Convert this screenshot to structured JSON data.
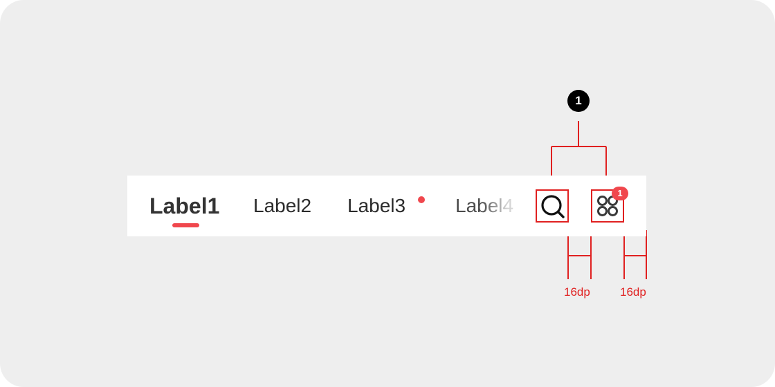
{
  "tabs": [
    {
      "label": "Label1",
      "active": true
    },
    {
      "label": "Label2",
      "active": false
    },
    {
      "label": "Label3",
      "active": false,
      "dot": true
    },
    {
      "label": "Label4",
      "active": false,
      "faded": true
    }
  ],
  "icons": {
    "search": "search-icon",
    "apps": "apps-grid-icon",
    "apps_badge": "1"
  },
  "annotation": {
    "callout_number": "1",
    "spacing_left": "16dp",
    "spacing_right": "16dp"
  },
  "colors": {
    "accent": "#f0474d",
    "annotation": "#e02020",
    "background": "#eeeeee"
  }
}
